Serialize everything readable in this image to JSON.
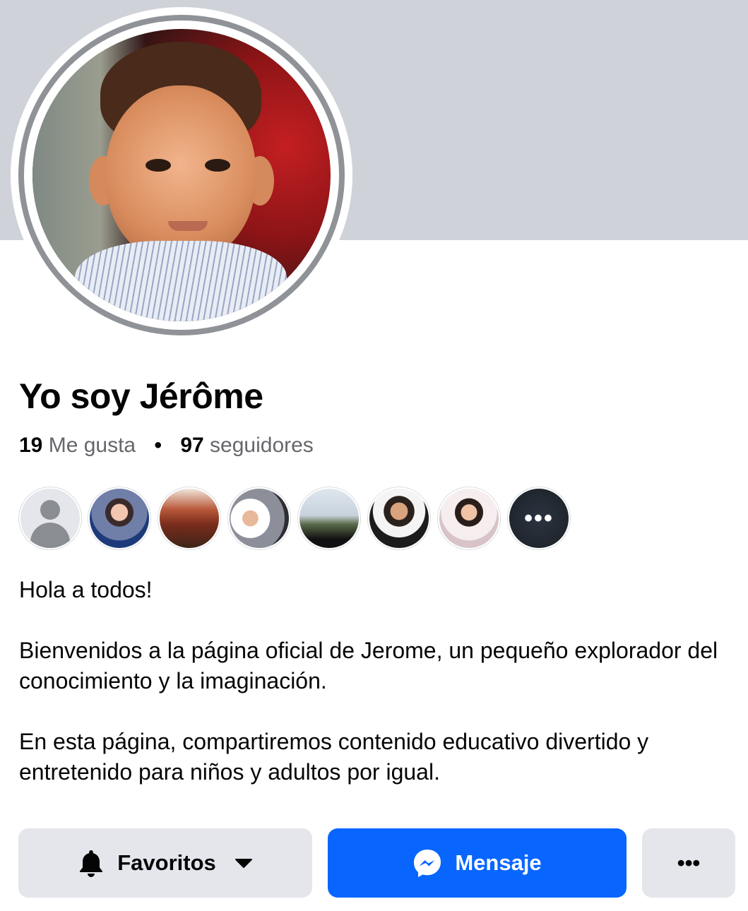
{
  "profile": {
    "name": "Yo soy Jérôme",
    "likes_count": "19",
    "likes_label": "Me gusta",
    "separator": "•",
    "followers_count": "97",
    "followers_label": "seguidores"
  },
  "followers_preview": {
    "more_label": "•••",
    "items": [
      {
        "type": "default-avatar"
      },
      {
        "type": "photo"
      },
      {
        "type": "photo"
      },
      {
        "type": "photo"
      },
      {
        "type": "photo"
      },
      {
        "type": "photo"
      },
      {
        "type": "photo"
      },
      {
        "type": "more"
      }
    ]
  },
  "bio": {
    "line1": "Hola a todos!",
    "line2": "Bienvenidos a la página oficial de Jerome, un pequeño explorador del conocimiento y la imaginación.",
    "line3": "En esta página, compartiremos contenido educativo divertido y entretenido para niños y adultos por igual."
  },
  "actions": {
    "favorites_label": "Favoritos",
    "favorites_icon": "bell-icon",
    "favorites_caret": "caret-down-icon",
    "message_label": "Mensaje",
    "message_icon": "messenger-icon",
    "more_label": "•••"
  },
  "colors": {
    "primary": "#0866ff",
    "secondary_button": "#e4e6eb",
    "cover": "#cfd3d9",
    "text_secondary": "#65676b"
  }
}
